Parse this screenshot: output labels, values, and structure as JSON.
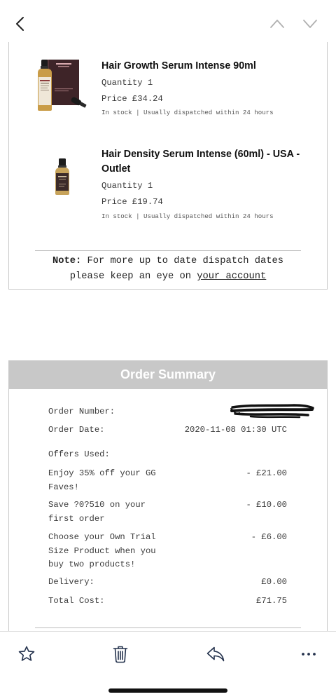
{
  "nav": {
    "back_icon": "chevron-left-icon",
    "previous_icon": "chevron-up-icon",
    "next_icon": "chevron-down-icon"
  },
  "products": [
    {
      "title": "Hair Growth Serum Intense 90ml",
      "quantity_label": "Quantity",
      "quantity": "1",
      "price_label": "Price",
      "price": "£34.24",
      "stock": "In stock | Usually dispatched within 24 hours"
    },
    {
      "title": "Hair Density Serum Intense (60ml) - USA - Outlet",
      "quantity_label": "Quantity",
      "quantity": "1",
      "price_label": "Price",
      "price": "£19.74",
      "stock": "In stock | Usually dispatched within 24 hours"
    }
  ],
  "note": {
    "label": "Note:",
    "text": "For more up to date dispatch dates please keep an eye on",
    "link": "your account"
  },
  "order_summary": {
    "heading": "Order Summary",
    "order_number_label": "Order Number:",
    "order_date_label": "Order Date:",
    "order_date": "2020-11-08 01:30 UTC",
    "offers_label": "Offers Used:",
    "offers": [
      {
        "label": "Enjoy 35% off your GG Faves!",
        "value": "- £21.00"
      },
      {
        "label": "Save ?0?510 on your first order",
        "value": "- £10.00"
      },
      {
        "label": "Choose your Own Trial Size Product when you buy two products!",
        "value": "- £6.00"
      }
    ],
    "delivery_label": "Delivery:",
    "delivery": "£0.00",
    "total_label": "Total Cost:",
    "total": "£71.75"
  },
  "toolbar": {
    "icons": [
      "star-icon",
      "trash-icon",
      "reply-icon",
      "more-icon"
    ]
  },
  "colors": {
    "summary_header": "#c8c8c8",
    "text": "#3a3a3a",
    "toolbar_icon": "#24324d"
  }
}
